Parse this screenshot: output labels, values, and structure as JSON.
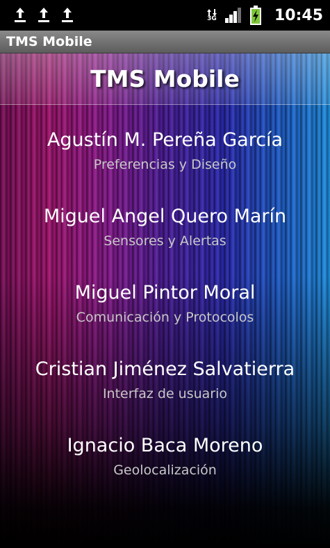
{
  "status_bar": {
    "notifications": [
      "upload-icon",
      "upload-icon",
      "upload-icon"
    ],
    "network_type": "3G",
    "clock": "10:45",
    "battery_color": "#7ec63a"
  },
  "title_bar": {
    "title": "TMS Mobile"
  },
  "header": {
    "title": "TMS Mobile"
  },
  "members": [
    {
      "name": "Agustín M. Pereña García",
      "role": "Preferencias y Diseño"
    },
    {
      "name": "Miguel Angel Quero Marín",
      "role": "Sensores y Alertas"
    },
    {
      "name": "Miguel Pintor Moral",
      "role": "Comunicación y Protocolos"
    },
    {
      "name": "Cristian Jiménez Salvatierra",
      "role": "Interfaz de usuario"
    },
    {
      "name": "Ignacio Baca Moreno",
      "role": "Geolocalización"
    }
  ]
}
